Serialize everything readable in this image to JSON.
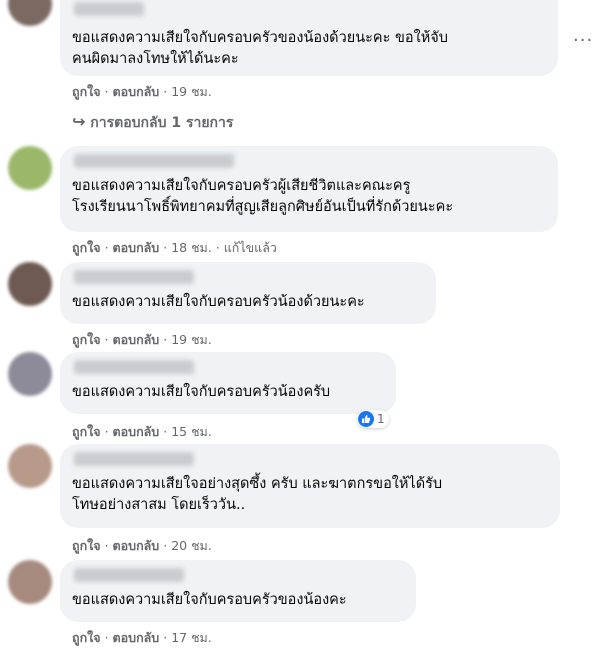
{
  "comments": [
    {
      "text_lines": [
        "ขอแสดงความเสียใจกับครอบครัวของน้องด้วยนะคะ ขอให้จับ",
        "คนผิดมาลงโทษให้ได้นะคะ"
      ],
      "like": "ถูกใจ",
      "reply": "ตอบกลับ",
      "time": "19 ชม.",
      "replies_label": "การตอบกลับ 1 รายการ",
      "avatar_color": "#7a6a62"
    },
    {
      "text_lines": [
        "ขอแสดงความเสียใจกับครอบครัวผู้เสียชีวิตและคณะครู",
        "โรงเรียนนาโพธิ์พิทยาคมที่สูญเสียลูกศิษย์อันเป็นที่รักด้วยนะคะ"
      ],
      "like": "ถูกใจ",
      "reply": "ตอบกลับ",
      "time": "18 ชม.",
      "edited": "แก้ไขแล้ว",
      "avatar_color": "#9bb86a"
    },
    {
      "text_lines": [
        "ขอแสดงความเสียใจกับครอบครัวน้องด้วยนะคะ"
      ],
      "like": "ถูกใจ",
      "reply": "ตอบกลับ",
      "time": "19 ชม.",
      "avatar_color": "#6e5a52"
    },
    {
      "text_lines": [
        "ขอแสดงความเสียใจกับครอบครัวน้องครับ"
      ],
      "like": "ถูกใจ",
      "reply": "ตอบกลับ",
      "time": "15 ชม.",
      "reaction_count": "1",
      "avatar_color": "#8d8a9a"
    },
    {
      "text_lines": [
        "ขอแสดงความเสียใจอย่างสุดซึ้ง ครับ และฆาตกรขอให้ได้รับ",
        "โทษอย่างสาสม โดยเร็ววัน.."
      ],
      "like": "ถูกใจ",
      "reply": "ตอบกลับ",
      "time": "20 ชม.",
      "avatar_color": "#b79a8a"
    },
    {
      "text_lines": [
        "ขอแสดงความเสียใจกับครอบครัวของน้องคะ"
      ],
      "like": "ถูกใจ",
      "reply": "ตอบกลับ",
      "time": "17 ชม.",
      "avatar_color": "#a78a7e"
    }
  ],
  "more_icon": "ellipsis-icon",
  "reply_arrow_icon": "reply-arrow-icon",
  "reaction_icon": "like-thumb-icon",
  "colors": {
    "bubble": "#f0f2f5",
    "meta": "#65676b",
    "like_blue": "#1877f2"
  }
}
